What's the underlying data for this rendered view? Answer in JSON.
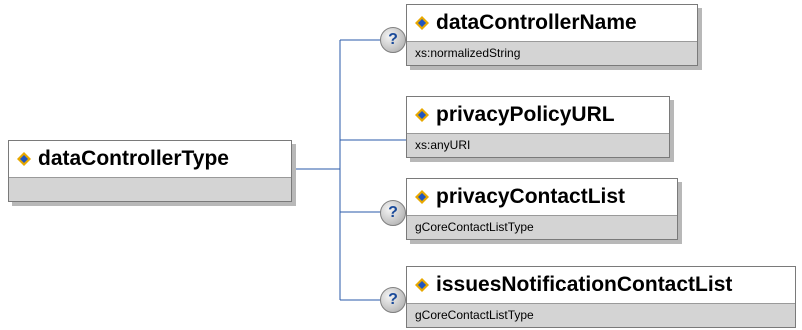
{
  "root": {
    "name": "dataControllerType",
    "type": ""
  },
  "children": [
    {
      "name": "dataControllerName",
      "type": "xs:normalizedString",
      "optional": true
    },
    {
      "name": "privacyPolicyURL",
      "type": "xs:anyURI",
      "optional": false
    },
    {
      "name": "privacyContactList",
      "type": "gCoreContactListType",
      "optional": true
    },
    {
      "name": "issuesNotificationContactList",
      "type": "gCoreContactListType",
      "optional": true
    }
  ],
  "optional_symbol": "?",
  "colors": {
    "line": "#2a5aa8",
    "icon_gold": "#e8a800",
    "icon_blue": "#1f55c0",
    "footer": "#d4d4d4"
  }
}
